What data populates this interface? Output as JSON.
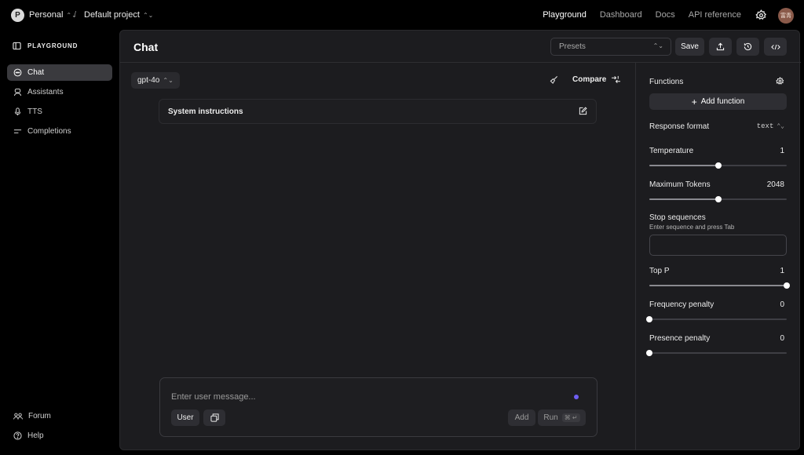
{
  "topbar": {
    "org_initial": "P",
    "org_name": "Personal",
    "separator": "/",
    "project_name": "Default project",
    "nav": [
      "Playground",
      "Dashboard",
      "Docs",
      "API reference"
    ],
    "active_nav": "Playground",
    "user_avatar_text": "富青"
  },
  "sidebar": {
    "title": "PLAYGROUND",
    "items": [
      {
        "label": "Chat",
        "icon": "chat-bubble-icon",
        "active": true
      },
      {
        "label": "Assistants",
        "icon": "assistant-icon",
        "active": false
      },
      {
        "label": "TTS",
        "icon": "microphone-icon",
        "active": false
      },
      {
        "label": "Completions",
        "icon": "lines-icon",
        "active": false
      }
    ],
    "footer": [
      {
        "label": "Forum",
        "icon": "people-icon"
      },
      {
        "label": "Help",
        "icon": "help-icon"
      }
    ]
  },
  "header": {
    "title": "Chat",
    "presets_placeholder": "Presets",
    "save_label": "Save"
  },
  "chat": {
    "model": "gpt-4o",
    "compare_label": "Compare",
    "system_label": "System instructions",
    "composer_placeholder": "Enter user message...",
    "role_label": "User",
    "add_label": "Add",
    "run_label": "Run",
    "run_shortcut": "⌘ ↵"
  },
  "settings": {
    "functions_label": "Functions",
    "add_function_label": "Add function",
    "response_format_label": "Response format",
    "response_format_value": "text",
    "temperature": {
      "label": "Temperature",
      "value": "1",
      "fraction": 0.5
    },
    "max_tokens": {
      "label": "Maximum Tokens",
      "value": "2048",
      "fraction": 0.5
    },
    "stop_sequences": {
      "label": "Stop sequences",
      "hint": "Enter sequence and press Tab"
    },
    "top_p": {
      "label": "Top P",
      "value": "1",
      "fraction": 1.0
    },
    "frequency_penalty": {
      "label": "Frequency penalty",
      "value": "0",
      "fraction": 0.0
    },
    "presence_penalty": {
      "label": "Presence penalty",
      "value": "0",
      "fraction": 0.0
    }
  },
  "colors": {
    "accent_dot": "#6e5ef2",
    "panel_bg": "#1c1c1f",
    "active_item_bg": "#3a3a3e"
  }
}
